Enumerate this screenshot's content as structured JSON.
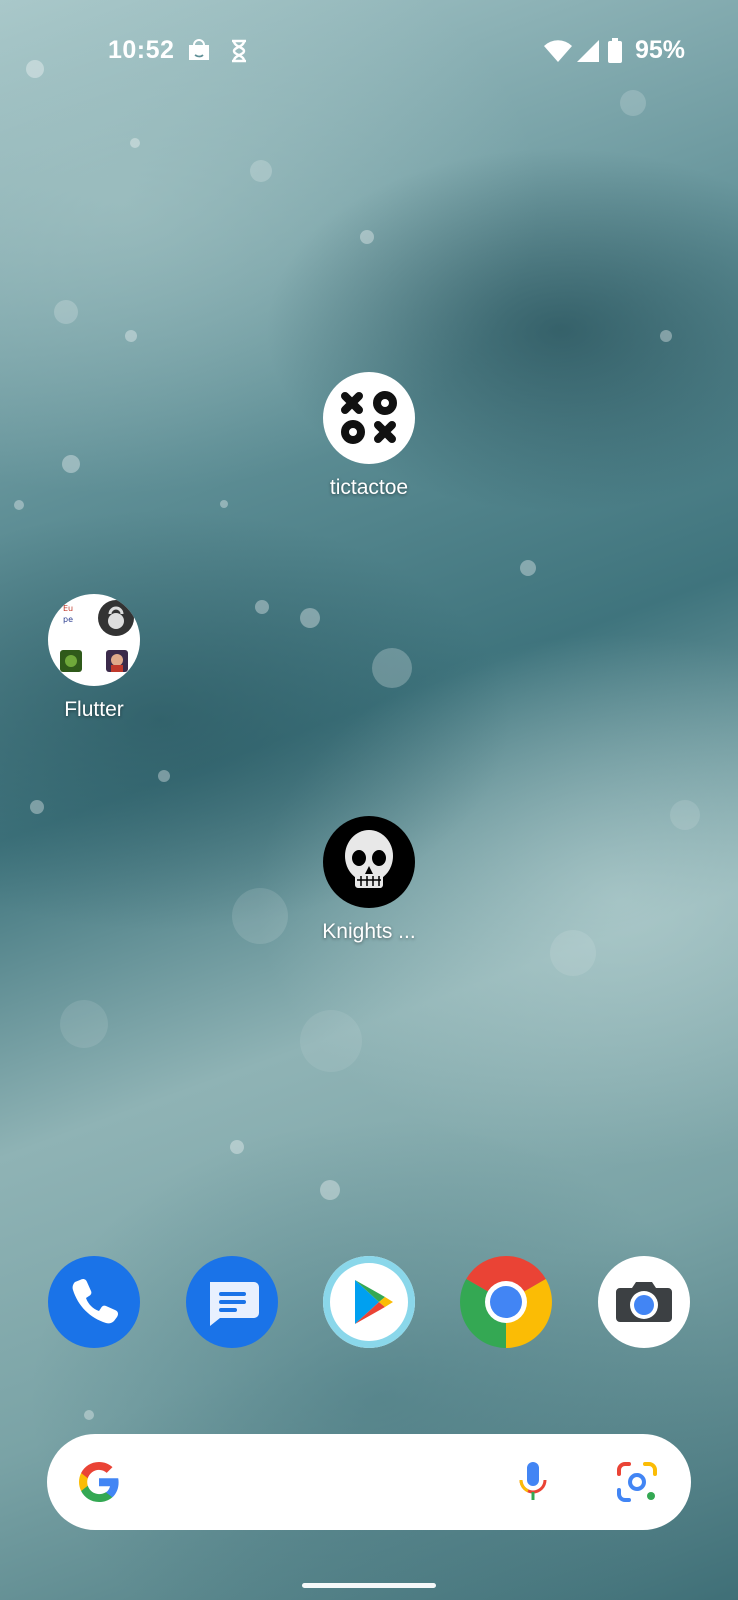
{
  "status_bar": {
    "time": "10:52",
    "battery_percent": "95%",
    "battery_level": 0.95,
    "left_icons": [
      "amazon-shopping-icon",
      "hourglass-icon"
    ],
    "right_icons": [
      "wifi-icon",
      "cell-signal-icon",
      "battery-icon"
    ]
  },
  "home": {
    "apps": [
      {
        "name": "tictactoe",
        "icon": "xo-ox-icon"
      },
      {
        "name": "Flutter",
        "icon": "folder-icon"
      },
      {
        "name": "Knights ...",
        "icon": "skull-icon"
      }
    ]
  },
  "dock": {
    "apps": [
      {
        "name": "Phone",
        "icon": "phone-icon",
        "color": "#1a73e8"
      },
      {
        "name": "Messages",
        "icon": "messages-icon",
        "color": "#1a73e8"
      },
      {
        "name": "Play Store",
        "icon": "play-store-icon",
        "color": "#ffffff"
      },
      {
        "name": "Chrome",
        "icon": "chrome-icon",
        "color": "#db4437"
      },
      {
        "name": "Camera",
        "icon": "camera-icon",
        "color": "#ffffff"
      }
    ]
  },
  "search": {
    "icons": [
      "google-g-icon",
      "microphone-icon",
      "google-lens-icon"
    ]
  },
  "colors": {
    "google_blue": "#4285f4",
    "google_red": "#ea4335",
    "google_yellow": "#fbbc05",
    "google_green": "#34a853"
  }
}
